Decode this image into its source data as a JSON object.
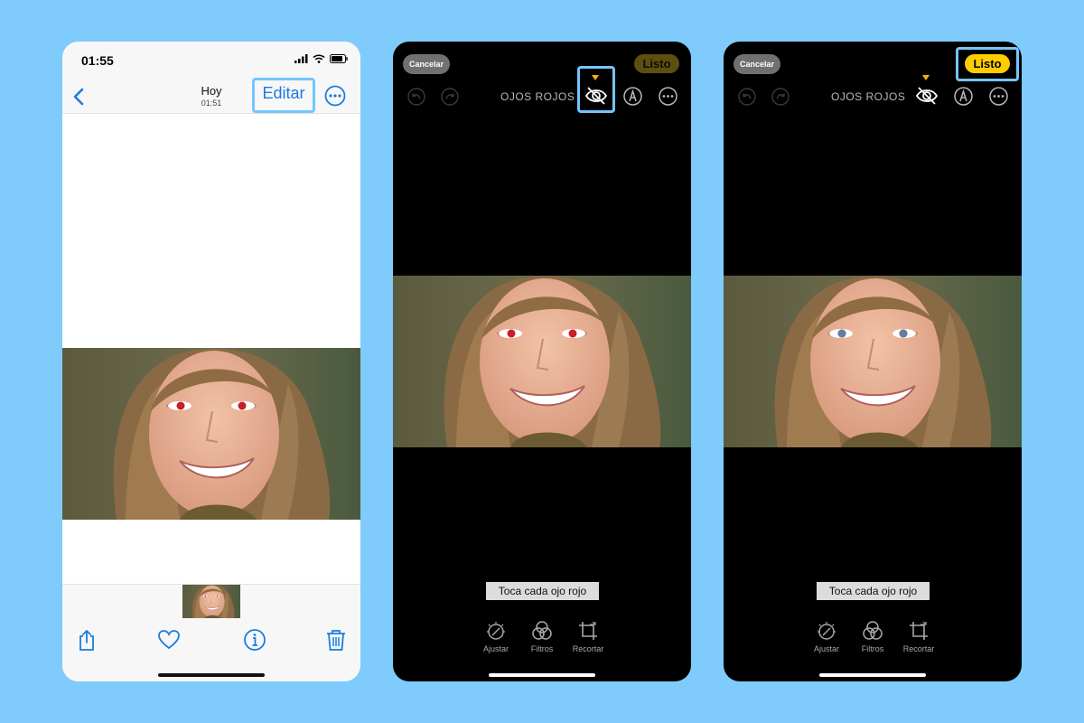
{
  "viewer": {
    "status_time": "01:55",
    "nav_title": "Hoy",
    "nav_subtitle": "01:51",
    "edit_label": "Editar"
  },
  "editor_before": {
    "cancel_label": "Cancelar",
    "done_label": "Listo",
    "mode_label": "OJOS ROJOS",
    "hint_label": "Toca cada ojo rojo",
    "tools": [
      "Ajustar",
      "Filtros",
      "Recortar"
    ]
  },
  "editor_after": {
    "cancel_label": "Cancelar",
    "done_label": "Listo",
    "mode_label": "OJOS ROJOS",
    "hint_label": "Toca cada ojo rojo",
    "tools": [
      "Ajustar",
      "Filtros",
      "Recortar"
    ]
  },
  "colors": {
    "background": "#7fcbfc",
    "highlight": "#73c6ff",
    "ios_blue": "#1a7be2",
    "done_yellow": "#ffcc00",
    "red_eye": "#c81e28",
    "fixed_eye": "#5f7ea0"
  },
  "icons": {
    "back": "chevron-left-icon",
    "more": "ellipsis-circle-icon",
    "share": "share-icon",
    "like": "heart-icon",
    "info": "info-icon",
    "delete": "trash-icon",
    "undo": "undo-icon",
    "redo": "redo-icon",
    "red_eye_tool": "red-eye-icon",
    "markup": "markup-pen-icon",
    "adjust": "adjust-dial-icon",
    "filters": "filters-icon",
    "crop": "crop-icon"
  }
}
